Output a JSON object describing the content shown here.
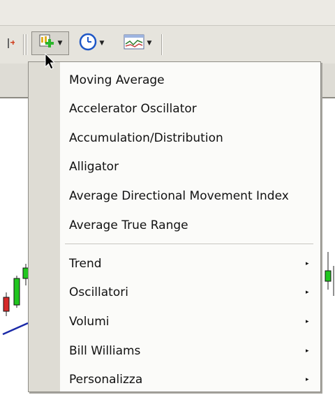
{
  "toolbar": {
    "buttons": [
      {
        "name": "add-indicator-button",
        "icon": "indicator-plus-icon",
        "has_dropdown": true,
        "pressed": true
      },
      {
        "name": "period-button",
        "icon": "clock-icon",
        "has_dropdown": true,
        "pressed": false
      },
      {
        "name": "templates-button",
        "icon": "chart-template-icon",
        "has_dropdown": true,
        "pressed": false
      }
    ]
  },
  "menu": {
    "items": [
      {
        "label": "Moving Average"
      },
      {
        "label": "Accelerator Oscillator"
      },
      {
        "label": "Accumulation/Distribution"
      },
      {
        "label": "Alligator"
      },
      {
        "label": "Average Directional Movement Index"
      },
      {
        "label": "Average True Range"
      }
    ],
    "submenus": [
      {
        "label": "Trend",
        "arrow": "▸"
      },
      {
        "label": "Oscillatori",
        "arrow": "▸"
      },
      {
        "label": "Volumi",
        "arrow": "▸"
      },
      {
        "label": "Bill Williams",
        "arrow": "▸"
      },
      {
        "label": "Personalizza",
        "arrow": "▸"
      }
    ]
  },
  "colors": {
    "candle_up": "#21c61f",
    "candle_down": "#d62a2a",
    "trend_line": "#1b2aa8",
    "toolbar": "#e6e4dd",
    "menu_gutter": "#dedcd4"
  }
}
